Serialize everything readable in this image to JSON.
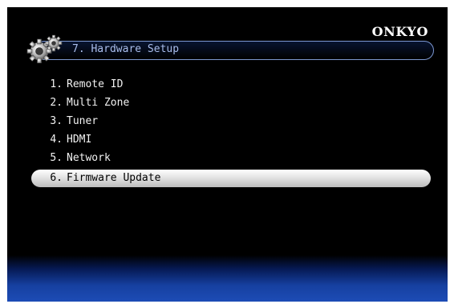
{
  "brand": "ONKYO",
  "header": {
    "title": "7. Hardware Setup",
    "icon": "gear-icon"
  },
  "menu": {
    "items": [
      {
        "number": "1.",
        "label": "Remote ID",
        "selected": false
      },
      {
        "number": "2.",
        "label": "Multi Zone",
        "selected": false
      },
      {
        "number": "3.",
        "label": "Tuner",
        "selected": false
      },
      {
        "number": "4.",
        "label": "HDMI",
        "selected": false
      },
      {
        "number": "5.",
        "label": "Network",
        "selected": false
      },
      {
        "number": "6.",
        "label": "Firmware Update",
        "selected": true
      }
    ]
  },
  "colors": {
    "background": "#000000",
    "title_border": "#7c98d2",
    "title_text": "#a9bdec",
    "selection": "#e3e3e3",
    "bottom_band": "#1d4cb6"
  }
}
